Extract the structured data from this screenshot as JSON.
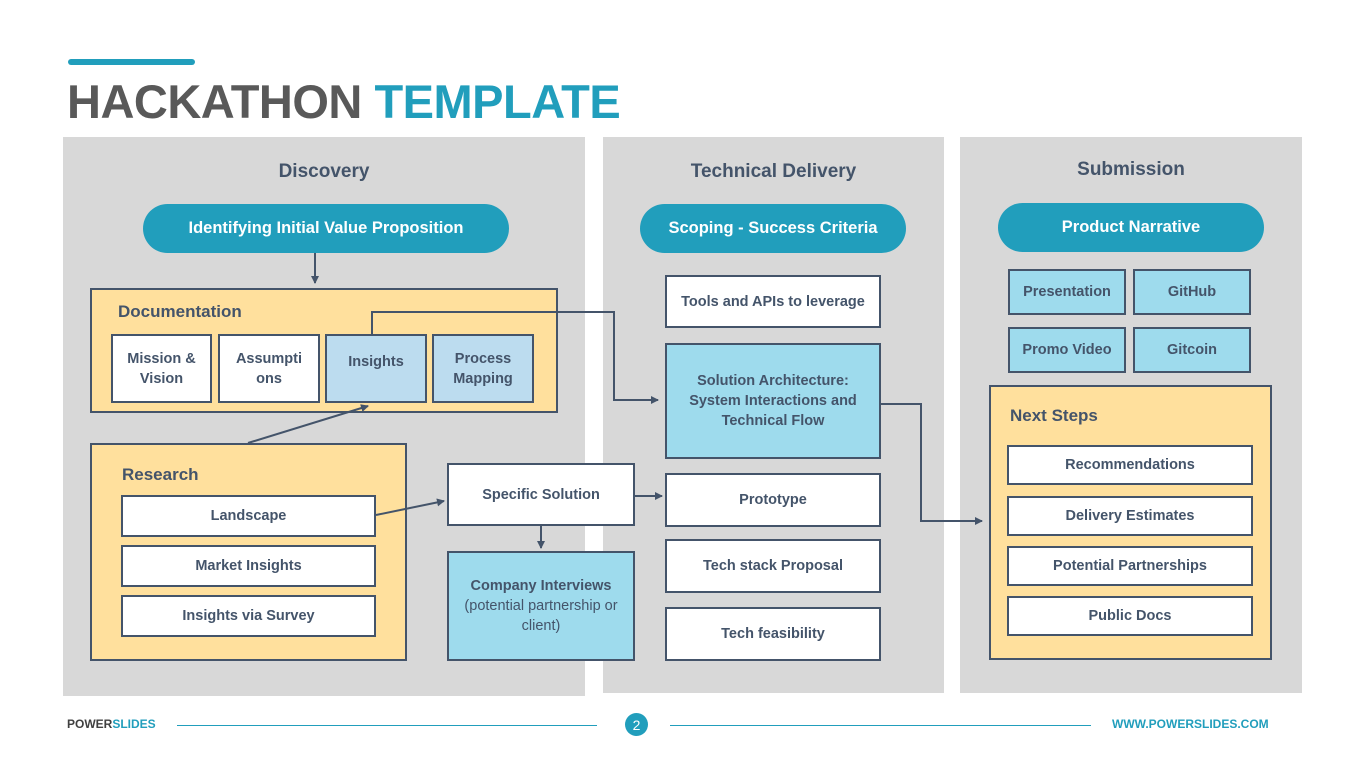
{
  "header": {
    "title_part1": "HACKATHON",
    "title_part2": "TEMPLATE"
  },
  "colors": {
    "accent": "#219ebc",
    "panel_bg": "#d8d8d8",
    "group_bg": "#ffe09d",
    "highlight_box": "#9edbed",
    "light_box": "#bcdcef",
    "text_dark": "#44546a"
  },
  "discovery": {
    "title": "Discovery",
    "pill": "Identifying Initial Value Proposition",
    "documentation": {
      "label": "Documentation",
      "items": [
        "Mission & Vision",
        "Assumpti ons",
        "Insights",
        "Process Mapping"
      ]
    },
    "research": {
      "label": "Research",
      "items": [
        "Landscape",
        "Market Insights",
        "Insights via Survey"
      ]
    },
    "specific_solution": "Specific Solution",
    "company_interviews": {
      "title": "Company Interviews",
      "subtitle": "(potential partnership or client)"
    }
  },
  "technical_delivery": {
    "title": "Technical Delivery",
    "pill": "Scoping - Success Criteria",
    "items": [
      "Tools and APIs to leverage",
      "Solution Architecture: System Interactions and Technical Flow",
      "Prototype",
      "Tech stack Proposal",
      "Tech feasibility"
    ]
  },
  "submission": {
    "title": "Submission",
    "pill": "Product Narrative",
    "deliverables": [
      "Presentation",
      "GitHub",
      "Promo Video",
      "Gitcoin"
    ],
    "next_steps": {
      "label": "Next Steps",
      "items": [
        "Recommendations",
        "Delivery Estimates",
        "Potential Partnerships",
        "Public Docs"
      ]
    }
  },
  "footer": {
    "brand_part1": "POWER",
    "brand_part2": "SLIDES",
    "page_number": "2",
    "url": "WWW.POWERSLIDES.COM"
  }
}
